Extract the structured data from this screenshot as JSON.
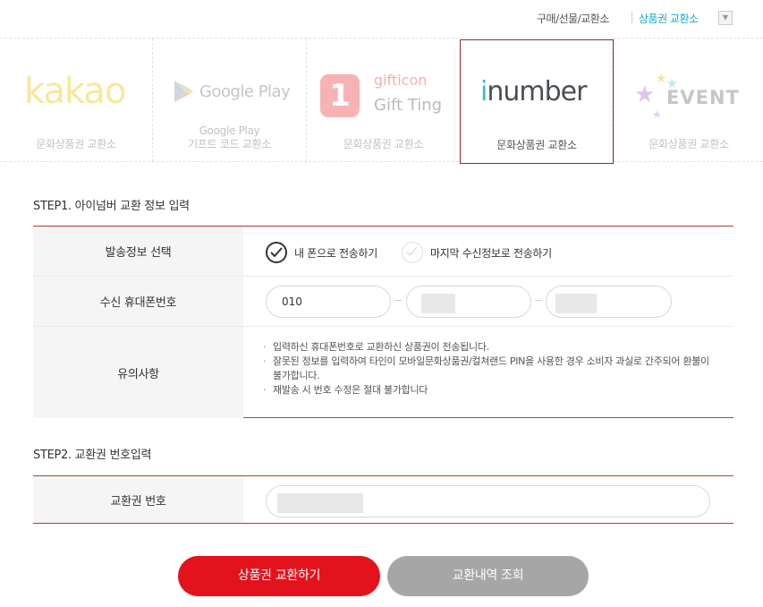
{
  "topnav": {
    "buy_gift_exchange": "구매/선물/교환소",
    "active_link": "상품권 교환소",
    "dropdown_icon": "▼"
  },
  "brand_tabs": [
    {
      "logo": "kakao",
      "label": "문화상품권 교환소",
      "selected": false
    },
    {
      "logo": "Google Play",
      "label": "Google Play\n기프트 코드 교환소",
      "label_line1": "Google Play",
      "label_line2": "기프트 코드 교환소",
      "selected": false
    },
    {
      "logo_line1": "gifticon",
      "logo_line2": "Gift Ting",
      "logo_box": "1",
      "label": "문화상품권 교환소",
      "selected": false
    },
    {
      "logo_prefix": "i",
      "logo_rest": "number",
      "label": "문화상품권 교환소",
      "selected": true
    },
    {
      "logo": "EVENT",
      "label": "문화상품권 교환소",
      "selected": false
    }
  ],
  "step1": {
    "title": "STEP1. 아이넘버 교환 정보 입력",
    "send_info_label": "발송정보 선택",
    "option_my_phone": "내 폰으로 전송하기",
    "option_last_recipient": "마지막 수신정보로 전송하기",
    "phone_label": "수신 휴대폰번호",
    "phone_prefix": "010",
    "notes_label": "유의사항",
    "notes": [
      "입력하신 휴대폰번호로 교환하신 상품권이 전송됩니다.",
      "잘못된 정보를 입력하여 타인이 모바일문화상품권/컬쳐랜드 PIN을 사용한 경우 소비자 과실로 간주되어 환불이 불가합니다.",
      "재발송 시 번호 수정은 절대 불가합니다"
    ]
  },
  "step2": {
    "title": "STEP2. 교환권 번호입력",
    "code_label": "교환권 번호"
  },
  "buttons": {
    "exchange": "상품권 교환하기",
    "history": "교환내역 조회"
  },
  "colors": {
    "accent_red": "#e3131d",
    "link_teal": "#1ea6c4",
    "table_border": "#b93a3a",
    "tab_selected_border": "#8b2a2a"
  }
}
